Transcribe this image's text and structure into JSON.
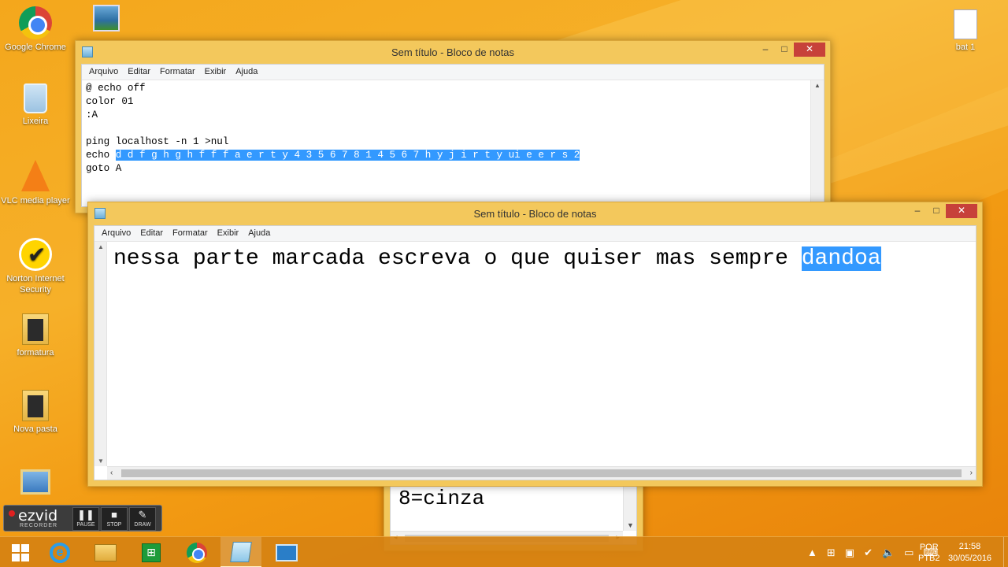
{
  "desktop": {
    "icons": [
      {
        "label": "Google Chrome"
      },
      {
        "label": "Lixeira"
      },
      {
        "label": "VLC media player"
      },
      {
        "label": "Norton Internet Security"
      },
      {
        "label": "formatura"
      },
      {
        "label": "Nova pasta"
      },
      {
        "label": "bat 1"
      }
    ]
  },
  "notepad_back": {
    "title": "Sem título - Bloco de notas",
    "menu": [
      "Arquivo",
      "Editar",
      "Formatar",
      "Exibir",
      "Ajuda"
    ],
    "lines": [
      "@ echo off",
      "color 01",
      ":A",
      "",
      "ping localhost -n 1 >nul"
    ],
    "echo_prefix": "echo ",
    "echo_selected": "d d f g h g h f f f a e r t y 4 3 5 6 7 8 1 4 5 6 7 h y j i r t y ui e e r s 2",
    "last_line": "goto A"
  },
  "notepad_front": {
    "title": "Sem título - Bloco de notas",
    "menu": [
      "Arquivo",
      "Editar",
      "Formatar",
      "Exibir",
      "Ajuda"
    ],
    "text_plain": "nessa parte marcada escreva o que quiser mas sempre ",
    "text_selected": "dandoa"
  },
  "notepad_bottom": {
    "text": "8=cinza"
  },
  "ezvid": {
    "logo": "ezvid",
    "subtitle": "RECORDER",
    "pause": "PAUSE",
    "stop": "STOP",
    "draw": "DRAW"
  },
  "taskbar": {
    "lang_top": "POR",
    "lang_bottom": "PTB2",
    "time": "21:58",
    "date": "30/05/2016"
  },
  "colors": {
    "selection": "#3399ff",
    "desktop_orange": "#f6b029",
    "window_frame": "#f3c85c",
    "close_button": "#c7413a"
  }
}
